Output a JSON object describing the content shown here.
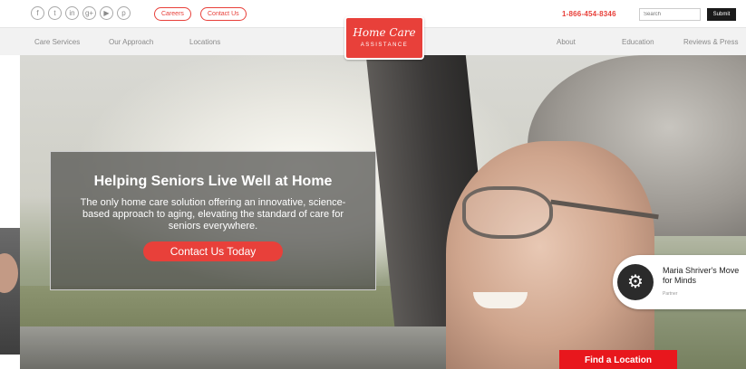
{
  "social_icons": [
    {
      "name": "facebook-icon",
      "glyph": "f"
    },
    {
      "name": "twitter-icon",
      "glyph": "t"
    },
    {
      "name": "linkedin-icon",
      "glyph": "in"
    },
    {
      "name": "googleplus-icon",
      "glyph": "g+"
    },
    {
      "name": "youtube-icon",
      "glyph": "▶"
    },
    {
      "name": "pinterest-icon",
      "glyph": "p"
    }
  ],
  "topbar": {
    "careers_label": "Careers",
    "contact_label": "Contact Us",
    "phone": "1-866-454-8346",
    "search_placeholder": "Search",
    "submit_label": "Submit"
  },
  "logo": {
    "script": "Home Care",
    "subtitle": "ASSISTANCE"
  },
  "nav": {
    "left": [
      "Care Services",
      "Our Approach",
      "Locations"
    ],
    "right": [
      "About",
      "Education",
      "Reviews & Press"
    ]
  },
  "hero": {
    "title": "Helping Seniors Live Well at Home",
    "body": "The only home care solution offering an innovative, science-based approach to aging, elevating the standard of care for seniors everywhere.",
    "cta_label": "Contact Us Today"
  },
  "badge": {
    "title": "Maria Shriver's Move for Minds",
    "subtitle": "Partner"
  },
  "find_location_label": "Find a Location",
  "colors": {
    "brand_red": "#e8403a",
    "cta_red": "#e8171d",
    "dark": "#1a1a1a"
  }
}
